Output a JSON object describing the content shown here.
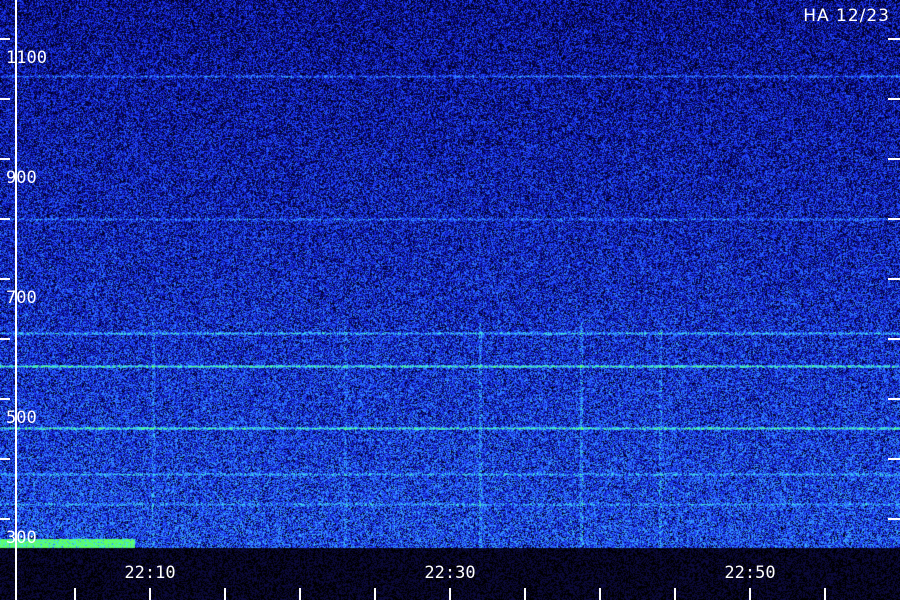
{
  "chart_data": {
    "type": "heatmap",
    "title": "HA 12/23",
    "xlabel": "",
    "ylabel": "",
    "x_ticks": [
      "22:10",
      "22:30",
      "22:50"
    ],
    "y_ticks": [
      300,
      500,
      700,
      900,
      1100
    ],
    "ylim": [
      270,
      1180
    ],
    "xlim_minutes": [
      -15,
      45
    ],
    "colormap": [
      "#000010",
      "#0a0a90",
      "#1e3cff",
      "#3aa0ff",
      "#40f0e0",
      "#60ff60"
    ],
    "background": "#000000"
  },
  "colors": {
    "axis": "#ffffff",
    "label": "#ffffff"
  }
}
